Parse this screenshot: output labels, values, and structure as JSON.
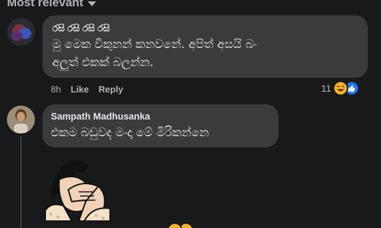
{
  "sort": {
    "label": "Most relevant"
  },
  "comments": [
    {
      "author": "රසි රසි රසි රසි",
      "text": "මු මෙක විකුනන් කනවනේ. අපිත් අසයි බං\nඅලුත් එකක් බලන්න.",
      "time": "8h",
      "like_label": "Like",
      "reply_label": "Reply",
      "reaction_count": "11",
      "reactions": [
        "haha-icon",
        "like-icon"
      ]
    },
    {
      "author": "Sampath Madhusanka",
      "text": "එකම බඩුවද මංදා මේ මිරිකන්නෙ",
      "sticker": "facepalm-sticker"
    }
  ],
  "colors": {
    "background": "#18191a",
    "bubble": "#3a3b3c",
    "text": "#e4e6eb",
    "secondary": "#b0b3b8",
    "like_blue": "#1877f2",
    "haha_yellow": "#f7b125"
  }
}
